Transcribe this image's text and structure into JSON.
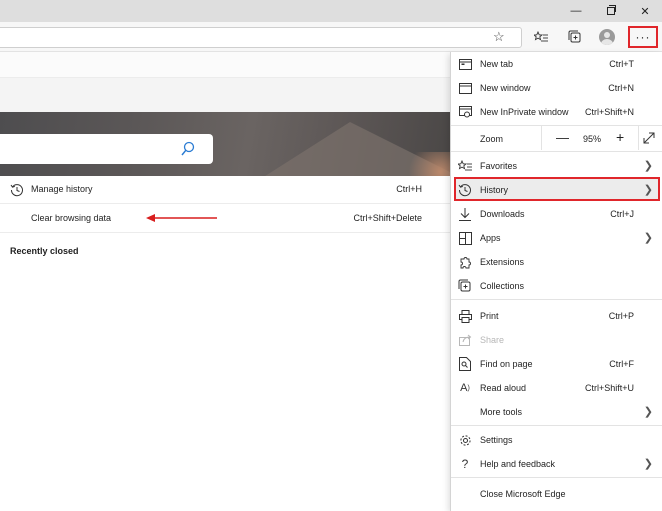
{
  "window": {
    "minimize_glyph": "—",
    "close_glyph": "✕"
  },
  "toolbar": {
    "more_glyph": "···"
  },
  "history_panel": {
    "manage_label": "Manage history",
    "manage_shortcut": "Ctrl+H",
    "clear_label": "Clear browsing data",
    "clear_shortcut": "Ctrl+Shift+Delete",
    "recent_heading": "Recently closed"
  },
  "menu": {
    "new_tab": {
      "label": "New tab",
      "shortcut": "Ctrl+T"
    },
    "new_window": {
      "label": "New window",
      "shortcut": "Ctrl+N"
    },
    "inprivate": {
      "label": "New InPrivate window",
      "shortcut": "Ctrl+Shift+N"
    },
    "zoom": {
      "label": "Zoom",
      "minus": "—",
      "value": "95%",
      "plus": "+"
    },
    "favorites": {
      "label": "Favorites"
    },
    "history": {
      "label": "History"
    },
    "downloads": {
      "label": "Downloads",
      "shortcut": "Ctrl+J"
    },
    "apps": {
      "label": "Apps"
    },
    "extensions": {
      "label": "Extensions"
    },
    "collections": {
      "label": "Collections"
    },
    "print": {
      "label": "Print",
      "shortcut": "Ctrl+P"
    },
    "share": {
      "label": "Share"
    },
    "find": {
      "label": "Find on page",
      "shortcut": "Ctrl+F"
    },
    "read_aloud": {
      "label": "Read aloud",
      "shortcut": "Ctrl+Shift+U"
    },
    "more_tools": {
      "label": "More tools"
    },
    "settings": {
      "label": "Settings"
    },
    "help": {
      "label": "Help and feedback"
    },
    "close": {
      "label": "Close Microsoft Edge"
    }
  },
  "colors": {
    "highlight": "#e0262b",
    "arrow": "#d81e1e"
  }
}
